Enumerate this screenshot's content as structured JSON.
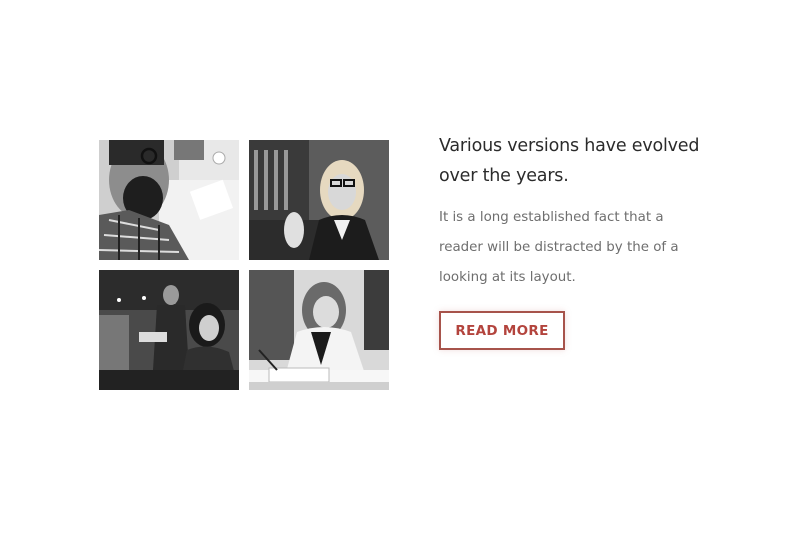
{
  "content": {
    "heading": "Various versions have evolved over the years.",
    "description": "It is a long established fact that a reader will be distracted by the of a looking at its layout.",
    "button_label": "READ MORE"
  },
  "gallery": {
    "photos": [
      {
        "icon": "bearded-man-with-glasses-photo"
      },
      {
        "icon": "blonde-woman-with-glasses-photo"
      },
      {
        "icon": "man-and-woman-in-cafe-photo"
      },
      {
        "icon": "smiling-woman-writing-photo"
      }
    ]
  },
  "colors": {
    "accent": "#b3443d",
    "button_border": "#a7534b",
    "heading": "#2b2b2b",
    "text": "#6e6e6e"
  }
}
